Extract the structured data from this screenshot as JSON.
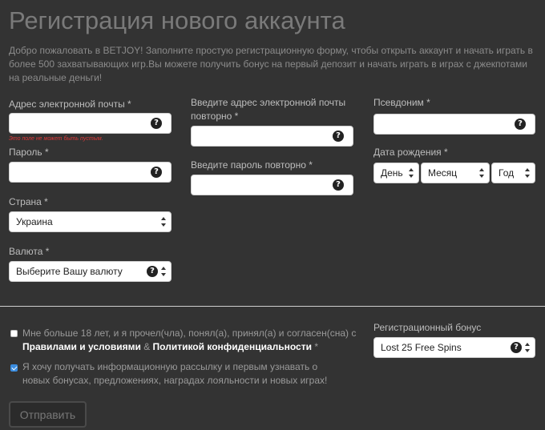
{
  "page": {
    "title": "Регистрация нового аккаунта",
    "intro": "Добро пожаловать в BETJOY! Заполните простую регистрационную форму, чтобы открыть аккаунт и начать играть в более 500 захватывающих игр.Вы можете получить бонус на первый депозит и начать играть в играх с джекпотами на реальные деньги!"
  },
  "form": {
    "email_label": "Адрес электронной почты *",
    "email_value": "",
    "email_error": "Это поле не может быть пустым.",
    "password_label": "Пароль *",
    "password_value": "",
    "country_label": "Страна *",
    "country_value": "Украина",
    "currency_label": "Валюта *",
    "currency_value": "Выберите Вашу валюту",
    "email_repeat_label": "Введите адрес электронной почты повторно *",
    "email_repeat_value": "",
    "password_repeat_label": "Введите пароль повторно *",
    "password_repeat_value": "",
    "nickname_label": "Псевдоним *",
    "nickname_value": "",
    "birthdate_label": "Дата рождения *",
    "birth_day": "День",
    "birth_month": "Месяц",
    "birth_year": "Год",
    "help_glyph": "?"
  },
  "agreements": {
    "age_text": "Мне больше 18 лет, и я прочел(чла), понял(а), принял(а) и согласен(сна) с",
    "terms_link": "Правилами и условиями",
    "amp": "&",
    "privacy_link": "Политикой конфиденциальности",
    "required_mark": "*",
    "age_checked": false,
    "newsletter_text": "Я хочу получать информационную рассылку и первым узнавать о новых бонусах, предложениях, наградах лояльности и новых играх!",
    "newsletter_checked": true
  },
  "bonus": {
    "label": "Регистрационный бонус",
    "value": "Lost 25 Free Spins"
  },
  "submit_label": "Отправить",
  "colors": {
    "background": "#333333",
    "error": "#e03b3b",
    "checkbox_accent": "#3b8de0"
  }
}
